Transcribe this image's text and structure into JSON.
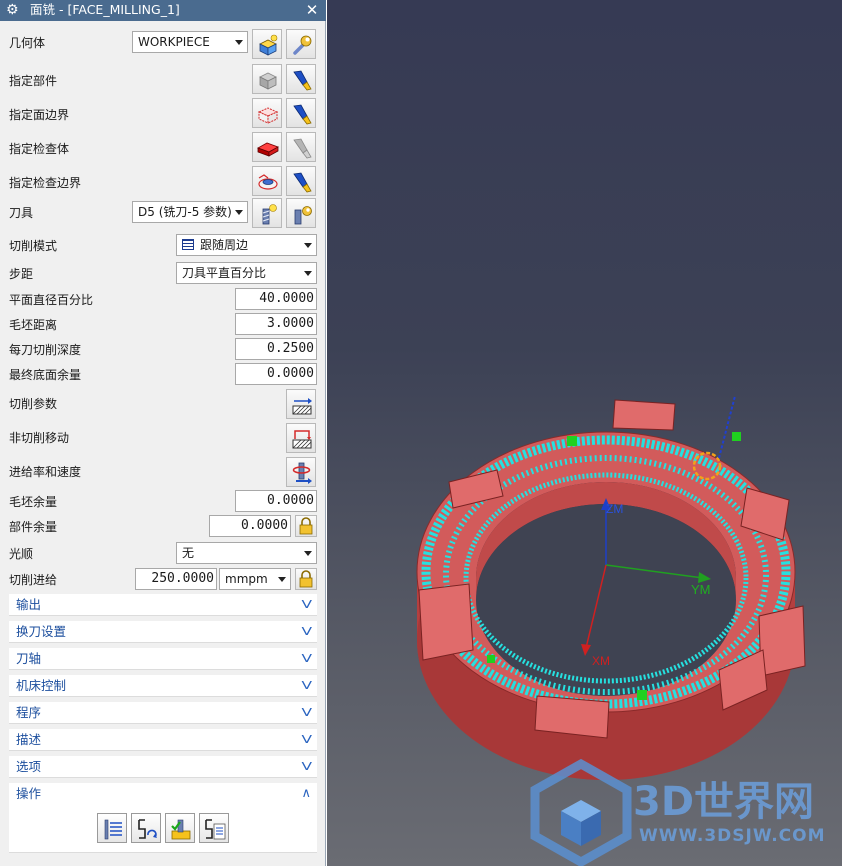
{
  "window": {
    "title": "面铣 - [FACE_MILLING_1]",
    "gear_icon": "⚙",
    "close_icon": "✕"
  },
  "form": {
    "geometry": {
      "label": "几何体",
      "value": "WORKPIECE"
    },
    "specify_part": {
      "label": "指定部件"
    },
    "specify_face_boundary": {
      "label": "指定面边界"
    },
    "specify_check_body": {
      "label": "指定检查体"
    },
    "specify_check_boundary": {
      "label": "指定检查边界"
    },
    "tool": {
      "label": "刀具",
      "value": "D5 (铣刀-5 参数)"
    },
    "cut_pattern": {
      "label": "切削模式",
      "value": "跟随周边"
    },
    "stepover": {
      "label": "步距",
      "value": "刀具平直百分比"
    },
    "flat_diameter_percent": {
      "label": "平面直径百分比",
      "value": "40.0000"
    },
    "blank_distance": {
      "label": "毛坯距离",
      "value": "3.0000"
    },
    "depth_per_cut": {
      "label": "每刀切削深度",
      "value": "0.2500"
    },
    "final_floor_stock": {
      "label": "最终底面余量",
      "value": "0.0000"
    },
    "cutting_parameters": {
      "label": "切削参数"
    },
    "non_cutting_moves": {
      "label": "非切削移动"
    },
    "feeds_speeds": {
      "label": "进给率和速度"
    },
    "blank_stock": {
      "label": "毛坯余量",
      "value": "0.0000"
    },
    "part_stock": {
      "label": "部件余量",
      "value": "0.0000"
    },
    "smoothing": {
      "label": "光顺",
      "value": "无"
    },
    "cut_feed": {
      "label": "切削进给",
      "value": "250.0000",
      "unit": "mmpm"
    }
  },
  "sections": [
    {
      "label": "输出",
      "expanded": false
    },
    {
      "label": "换刀设置",
      "expanded": false
    },
    {
      "label": "刀轴",
      "expanded": false
    },
    {
      "label": "机床控制",
      "expanded": false
    },
    {
      "label": "程序",
      "expanded": false
    },
    {
      "label": "描述",
      "expanded": false
    },
    {
      "label": "选项",
      "expanded": false
    },
    {
      "label": "操作",
      "expanded": true
    }
  ],
  "chevrons": {
    "down": "V",
    "up": "∧"
  },
  "actions": [
    "generate-icon",
    "replay-icon",
    "verify-icon",
    "list-icon"
  ],
  "viewport": {
    "axis_labels": {
      "x": "XM",
      "y": "YM",
      "z": "ZM"
    },
    "watermark": {
      "text": "3D世界网",
      "url": "WWW.3DSJW.COM"
    }
  },
  "colors": {
    "title_bar": "#4a6b8f",
    "part_body": "#d25b5b",
    "part_side": "#b53f3f",
    "toolpath": "#26e0e0",
    "section_text": "#1d4f9e",
    "watermark": "#5a8fd0"
  }
}
